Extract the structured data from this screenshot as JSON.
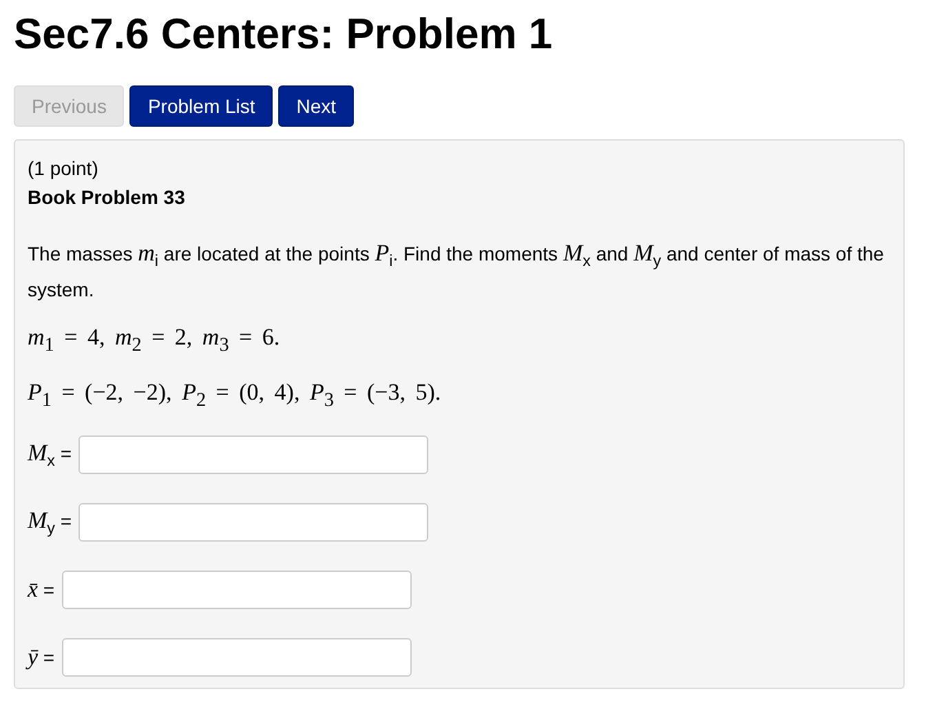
{
  "title": "Sec7.6 Centers: Problem 1",
  "buttons": [
    {
      "label": "Previous",
      "disabled": true
    },
    {
      "label": "Problem List",
      "disabled": false
    },
    {
      "label": "Next",
      "disabled": false
    }
  ],
  "problem": {
    "points": "(1 point)",
    "source": "Book Problem 33",
    "statement": "The masses *m*$_{i}$ are located at the points *P*$_{i}$. Find the moments *M*$_{x}$ and *M*$_{y}$ and center of mass of the system.",
    "masses": "*m*$_{1}$ = 4,  *m*$_{2}$ = 2,  *m*$_{3}$ = 6.",
    "positions": "*P*$_{1}$ = (−2, −2),  *P*$_{2}$ = (0, 4),  *P*$_{3}$ = (−3, 5).",
    "fields": [
      {
        "label": "*M*$_{x}$ ="
      },
      {
        "label": "*M*$_{y}$ ="
      },
      {
        "label": "*x̄* ="
      },
      {
        "label": "*ȳ* ="
      }
    ]
  }
}
